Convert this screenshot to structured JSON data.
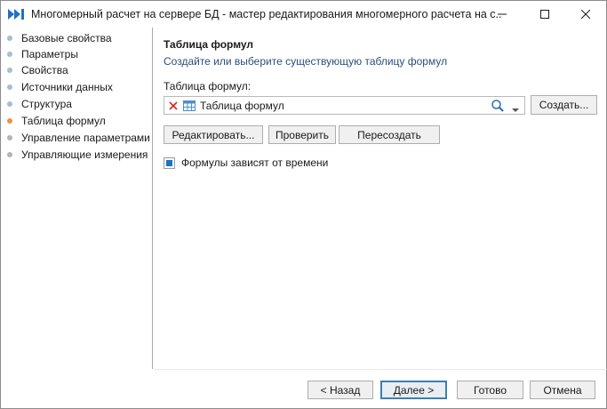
{
  "window": {
    "title": "Многомерный расчет на сервере БД - мастер редактирования многомерного расчета на с..."
  },
  "colors": {
    "accent": "#1f72c4",
    "dot_inactive": "#a9bcd0",
    "dot_active": "#f0913a",
    "dot_future": "#b4b4b4",
    "description_text": "#2a4f7a"
  },
  "sidebar": {
    "items": [
      {
        "label": "Базовые свойства",
        "state": "done"
      },
      {
        "label": "Параметры",
        "state": "done"
      },
      {
        "label": "Свойства",
        "state": "done"
      },
      {
        "label": "Источники данных",
        "state": "done"
      },
      {
        "label": "Структура",
        "state": "done"
      },
      {
        "label": "Таблица формул",
        "state": "active"
      },
      {
        "label": "Управление параметрами",
        "state": "future"
      },
      {
        "label": "Управляющие измерения",
        "state": "future"
      }
    ]
  },
  "main": {
    "title": "Таблица формул",
    "description": "Создайте или выберите существующую таблицу формул",
    "field_label": "Таблица формул:",
    "combo_value": "Таблица формул",
    "create_button": "Создать...",
    "edit_button": "Редактировать...",
    "check_button": "Проверить",
    "recreate_button": "Пересоздать",
    "time_dependent_label": "Формулы зависят от времени",
    "time_dependent_checked": true
  },
  "footer": {
    "back_button": "< Назад",
    "next_button": "Далее >",
    "done_button": "Готово",
    "cancel_button": "Отмена"
  },
  "icons": {
    "app": "double-arrow-icon",
    "clear": "red-x-icon",
    "table": "table-icon",
    "search": "magnifier-icon",
    "dropdown": "chevron-down-icon"
  }
}
